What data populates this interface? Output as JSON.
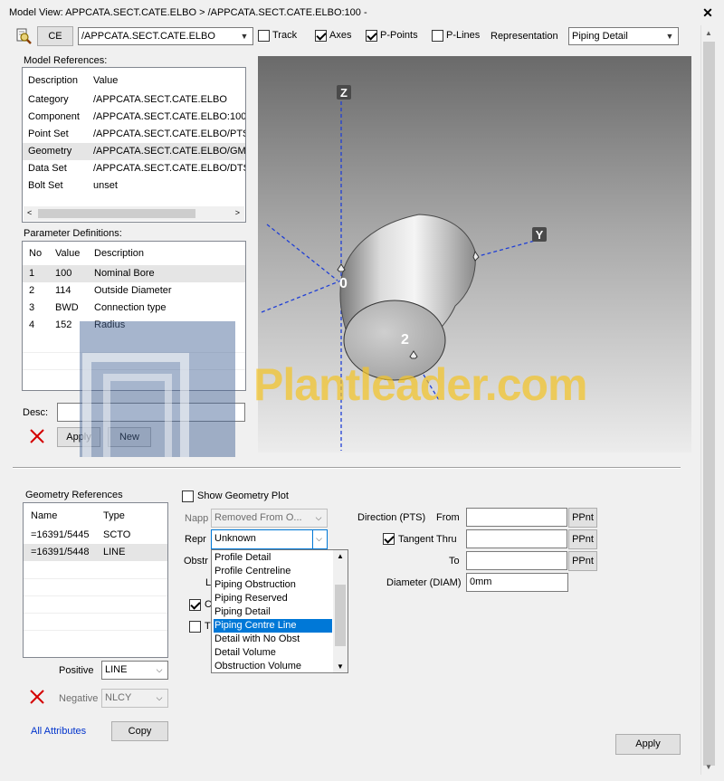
{
  "window": {
    "title": "Model View: APPCATA.SECT.CATE.ELBO > /APPCATA.SECT.CATE.ELBO:100 -",
    "close": "✕"
  },
  "toolbar": {
    "ce_label": "CE",
    "element_value": "/APPCATA.SECT.CATE.ELBO",
    "track_label": "Track",
    "track_checked": false,
    "axes_label": "Axes",
    "axes_checked": true,
    "ppoints_label": "P-Points",
    "ppoints_checked": true,
    "plines_label": "P-Lines",
    "plines_checked": false,
    "representation_label": "Representation",
    "representation_value": "Piping Detail"
  },
  "model_references": {
    "title": "Model References:",
    "headers": [
      "Description",
      "Value"
    ],
    "rows": [
      {
        "desc": "Category",
        "value": "/APPCATA.SECT.CATE.ELBO"
      },
      {
        "desc": "Component",
        "value": "/APPCATA.SECT.CATE.ELBO:100"
      },
      {
        "desc": "Point Set",
        "value": "/APPCATA.SECT.CATE.ELBO/PTSE"
      },
      {
        "desc": "Geometry",
        "value": "/APPCATA.SECT.CATE.ELBO/GMSE"
      },
      {
        "desc": "Data Set",
        "value": "/APPCATA.SECT.CATE.ELBO/DTSE"
      },
      {
        "desc": "Bolt Set",
        "value": "unset"
      }
    ]
  },
  "parameter_definitions": {
    "title": "Parameter Definitions:",
    "headers": [
      "No",
      "Value",
      "Description"
    ],
    "rows": [
      {
        "no": "1",
        "value": "100",
        "desc": "Nominal Bore"
      },
      {
        "no": "2",
        "value": "114",
        "desc": "Outside Diameter"
      },
      {
        "no": "3",
        "value": "BWD",
        "desc": "Connection type"
      },
      {
        "no": "4",
        "value": "152",
        "desc": "Radius"
      }
    ]
  },
  "desc_form": {
    "label": "Desc:",
    "value": "",
    "apply_label": "Apply",
    "new_label": "New"
  },
  "viewport": {
    "axis_z": "Z",
    "axis_y": "Y",
    "ppoint_0": "0",
    "ppoint_2": "2",
    "watermark": "Plantleader.com"
  },
  "geometry_references": {
    "title": "Geometry References",
    "headers": [
      "Name",
      "Type"
    ],
    "rows": [
      {
        "name": "=16391/5445",
        "type": "SCTO"
      },
      {
        "name": "=16391/5448",
        "type": "LINE"
      }
    ],
    "positive_label": "Positive",
    "positive_value": "LINE",
    "negative_label": "Negative",
    "negative_value": "NLCY",
    "all_attributes_label": "All Attributes",
    "copy_label": "Copy"
  },
  "geometry_form": {
    "show_plot_label": "Show Geometry Plot",
    "napp_label": "Napp",
    "napp_value": "Removed From O...",
    "repr_label": "Repr",
    "repr_value": "Unknown",
    "obstr_label": "Obstr",
    "l_label": "L",
    "c_label": "C",
    "t_label": "T",
    "repr_options": [
      "Profile Detail",
      "Profile Centreline",
      "Piping Obstruction",
      "Piping Reserved",
      "Piping Detail",
      "Piping Centre Line",
      "Detail with No Obst",
      "Detail Volume",
      "Obstruction Volume"
    ],
    "repr_highlighted": "Piping Centre Line",
    "direction_label": "Direction (PTS)",
    "from_label": "From",
    "from_value": "",
    "ppnt_label": "PPnt",
    "tangent_label": "Tangent Thru",
    "tangent_checked": true,
    "tangent_value": "",
    "to_label": "To",
    "to_value": "",
    "diameter_label": "Diameter (DIAM)",
    "diameter_value": "0mm",
    "apply_label": "Apply"
  },
  "colors": {
    "viewport_top": "#6a6a6a",
    "viewport_bottom": "#e8e8e8",
    "axis_blue": "#1f3fd6",
    "highlight": "#0078d7",
    "watermark": "#f2c428"
  }
}
